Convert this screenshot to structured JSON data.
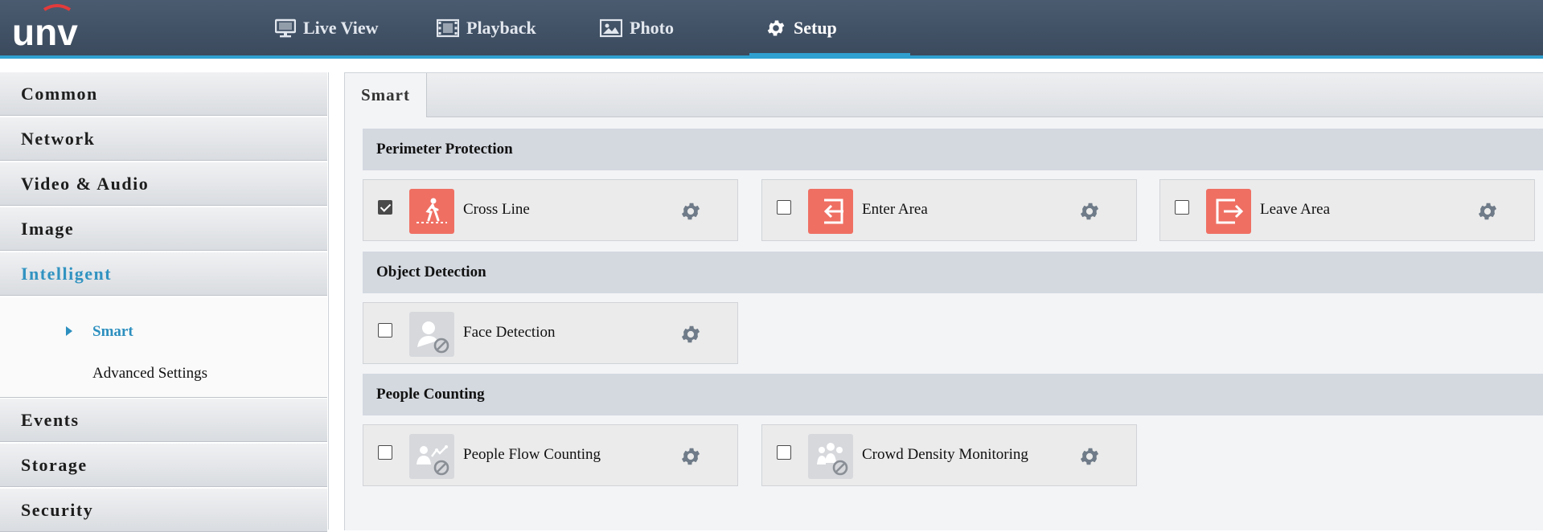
{
  "brand": {
    "logo_text": "unv"
  },
  "nav": {
    "live_view": "Live View",
    "playback": "Playback",
    "photo": "Photo",
    "setup": "Setup"
  },
  "sidebar": {
    "items": [
      "Common",
      "Network",
      "Video & Audio",
      "Image",
      "Intelligent",
      "Events",
      "Storage",
      "Security"
    ],
    "active": "Intelligent",
    "sub_items": [
      "Smart",
      "Advanced Settings"
    ],
    "active_sub": "Smart"
  },
  "tabs": {
    "smart": "Smart"
  },
  "sections": [
    {
      "title": "Perimeter Protection",
      "items": [
        {
          "label": "Cross Line",
          "checked": true,
          "enabled": true
        },
        {
          "label": "Enter Area",
          "checked": false,
          "enabled": true
        },
        {
          "label": "Leave Area",
          "checked": false,
          "enabled": true
        }
      ]
    },
    {
      "title": "Object Detection",
      "items": [
        {
          "label": "Face Detection",
          "checked": false,
          "enabled": false
        }
      ]
    },
    {
      "title": "People Counting",
      "items": [
        {
          "label": "People Flow Counting",
          "checked": false,
          "enabled": false
        },
        {
          "label": "Crowd Density Monitoring",
          "checked": false,
          "enabled": false
        }
      ]
    }
  ],
  "colors": {
    "topbar": "#3f4f63",
    "accent": "#2fa0d0",
    "active_text": "#3193c1",
    "icon_enabled": "#ef6f63",
    "icon_disabled": "#d6d8dc",
    "gear": "#6f7b88"
  },
  "icons": {
    "live_view": "monitor-icon",
    "playback": "film-icon",
    "photo": "picture-icon",
    "setup": "gear-icon",
    "settings": "gear-icon"
  }
}
